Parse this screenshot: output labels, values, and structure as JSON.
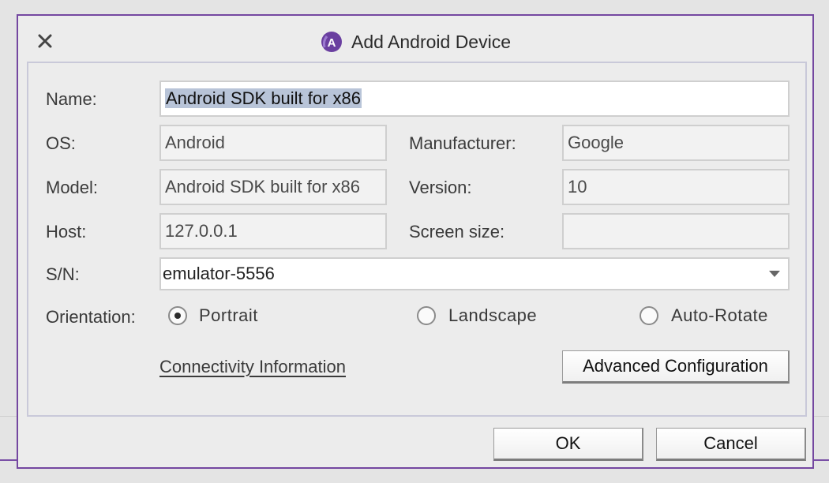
{
  "dialog": {
    "title": "Add Android Device",
    "title_icon": "android-studio-logo-icon",
    "close_icon": "close-icon"
  },
  "form": {
    "name_label": "Name:",
    "name_value": "Android SDK built for x86",
    "os_label": "OS:",
    "os_value": "Android",
    "manufacturer_label": "Manufacturer:",
    "manufacturer_value": "Google",
    "model_label": "Model:",
    "model_value": "Android SDK built for x86",
    "version_label": "Version:",
    "version_value": "10",
    "host_label": "Host:",
    "host_value": "127.0.0.1",
    "screen_size_label": "Screen size:",
    "screen_size_value": "",
    "sn_label": "S/N:",
    "sn_value": "emulator-5556",
    "orientation_label": "Orientation:",
    "orientation_options": [
      "Portrait",
      "Landscape",
      "Auto-Rotate"
    ],
    "orientation_selected": "Portrait",
    "connectivity_link": "Connectivity Information",
    "advanced_button": "Advanced Configuration"
  },
  "footer": {
    "ok_label": "OK",
    "cancel_label": "Cancel"
  },
  "colors": {
    "accent_purple": "#7447a0",
    "selection": "#b8c4d8"
  }
}
